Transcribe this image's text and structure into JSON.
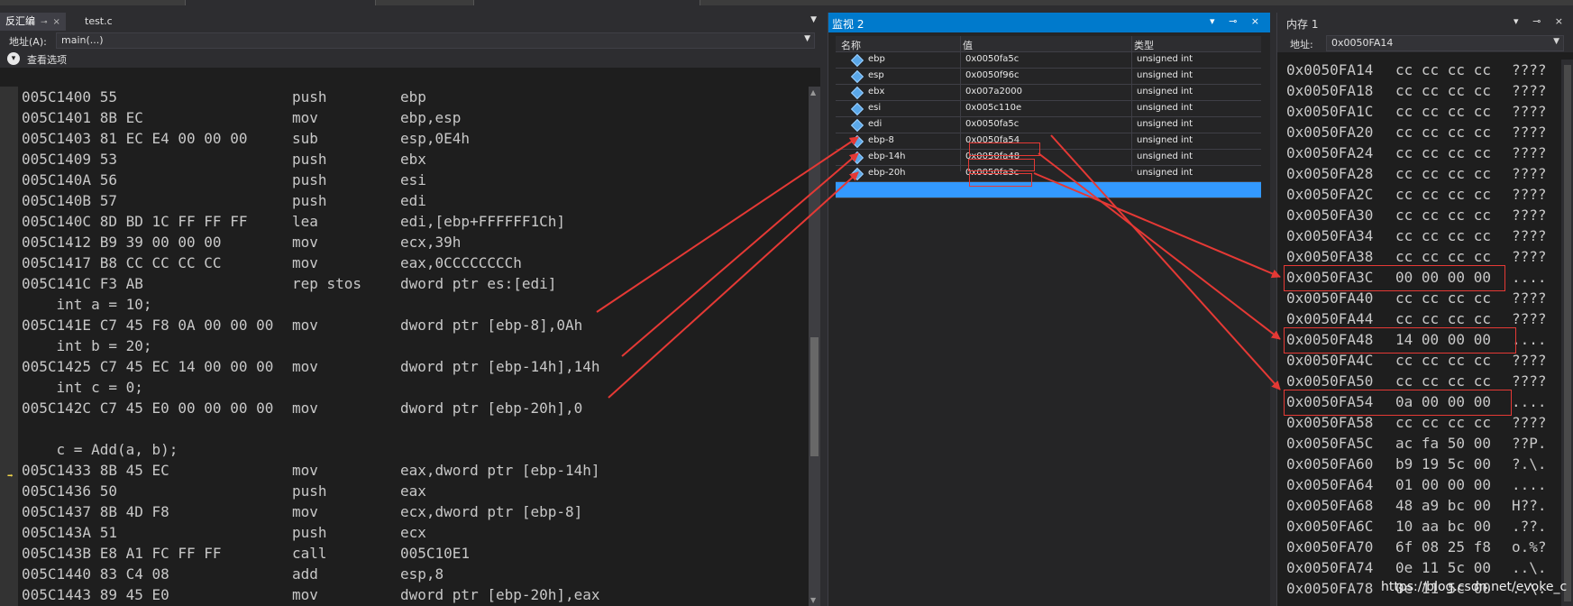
{
  "disasm_tabs": [
    {
      "label": "反汇编",
      "pin": "⊸",
      "close": "×"
    },
    {
      "label": "test.c"
    }
  ],
  "address_label": "地址(A):",
  "address_value": "main(...)",
  "view_options": "查看选项",
  "code_lines": [
    {
      "addr": "005C1400 55",
      "op": "push",
      "args": "ebp"
    },
    {
      "addr": "005C1401 8B EC",
      "op": "mov",
      "args": "ebp,esp"
    },
    {
      "addr": "005C1403 81 EC E4 00 00 00",
      "op": "sub",
      "args": "esp,0E4h"
    },
    {
      "addr": "005C1409 53",
      "op": "push",
      "args": "ebx"
    },
    {
      "addr": "005C140A 56",
      "op": "push",
      "args": "esi"
    },
    {
      "addr": "005C140B 57",
      "op": "push",
      "args": "edi"
    },
    {
      "addr": "005C140C 8D BD 1C FF FF FF",
      "op": "lea",
      "args": "edi,[ebp+FFFFFF1Ch]"
    },
    {
      "addr": "005C1412 B9 39 00 00 00",
      "op": "mov",
      "args": "ecx,39h"
    },
    {
      "addr": "005C1417 B8 CC CC CC CC",
      "op": "mov",
      "args": "eax,0CCCCCCCCh"
    },
    {
      "addr": "005C141C F3 AB",
      "op": "rep stos",
      "args": "dword ptr es:[edi]"
    },
    {
      "src": "    int a = 10;"
    },
    {
      "addr": "005C141E C7 45 F8 0A 00 00 00",
      "op": "mov",
      "args": "dword ptr [ebp-8],0Ah"
    },
    {
      "src": "    int b = 20;"
    },
    {
      "addr": "005C1425 C7 45 EC 14 00 00 00",
      "op": "mov",
      "args": "dword ptr [ebp-14h],14h"
    },
    {
      "src": "    int c = 0;"
    },
    {
      "addr": "005C142C C7 45 E0 00 00 00 00",
      "op": "mov",
      "args": "dword ptr [ebp-20h],0"
    },
    {
      "src": ""
    },
    {
      "src": "    c = Add(a, b);"
    },
    {
      "addr": "005C1433 8B 45 EC",
      "op": "mov",
      "args": "eax,dword ptr [ebp-14h]",
      "current": true
    },
    {
      "addr": "005C1436 50",
      "op": "push",
      "args": "eax"
    },
    {
      "addr": "005C1437 8B 4D F8",
      "op": "mov",
      "args": "ecx,dword ptr [ebp-8]"
    },
    {
      "addr": "005C143A 51",
      "op": "push",
      "args": "ecx"
    },
    {
      "addr": "005C143B E8 A1 FC FF FF",
      "op": "call",
      "args": "005C10E1"
    },
    {
      "addr": "005C1440 83 C4 08",
      "op": "add",
      "args": "esp,8"
    },
    {
      "addr": "005C1443 89 45 E0",
      "op": "mov",
      "args": "dword ptr [ebp-20h],eax"
    }
  ],
  "watch": {
    "title": "监视 2",
    "tools": "▾ ⊸ ×",
    "headers": {
      "name": "名称",
      "value": "值",
      "type": "类型"
    },
    "rows": [
      {
        "name": "ebp",
        "value": "0x0050fa5c",
        "type": "unsigned int"
      },
      {
        "name": "esp",
        "value": "0x0050f96c",
        "type": "unsigned int"
      },
      {
        "name": "ebx",
        "value": "0x007a2000",
        "type": "unsigned int"
      },
      {
        "name": "esi",
        "value": "0x005c110e",
        "type": "unsigned int"
      },
      {
        "name": "edi",
        "value": "0x0050fa5c",
        "type": "unsigned int"
      },
      {
        "name": "ebp-8",
        "value": "0x0050fa54",
        "type": "unsigned int"
      },
      {
        "name": "ebp-14h",
        "value": "0x0050fa48",
        "type": "unsigned int"
      },
      {
        "name": "ebp-20h",
        "value": "0x0050fa3c",
        "type": "unsigned int"
      }
    ]
  },
  "memory": {
    "title": "内存 1",
    "tools": "▾ ⊸ ×",
    "address_label": "地址:",
    "address_value": "0x0050FA14",
    "lines": [
      {
        "addr": "0x0050FA14",
        "bytes": "cc cc cc cc",
        "ascii": "????"
      },
      {
        "addr": "0x0050FA18",
        "bytes": "cc cc cc cc",
        "ascii": "????"
      },
      {
        "addr": "0x0050FA1C",
        "bytes": "cc cc cc cc",
        "ascii": "????"
      },
      {
        "addr": "0x0050FA20",
        "bytes": "cc cc cc cc",
        "ascii": "????"
      },
      {
        "addr": "0x0050FA24",
        "bytes": "cc cc cc cc",
        "ascii": "????"
      },
      {
        "addr": "0x0050FA28",
        "bytes": "cc cc cc cc",
        "ascii": "????"
      },
      {
        "addr": "0x0050FA2C",
        "bytes": "cc cc cc cc",
        "ascii": "????"
      },
      {
        "addr": "0x0050FA30",
        "bytes": "cc cc cc cc",
        "ascii": "????"
      },
      {
        "addr": "0x0050FA34",
        "bytes": "cc cc cc cc",
        "ascii": "????"
      },
      {
        "addr": "0x0050FA38",
        "bytes": "cc cc cc cc",
        "ascii": "????"
      },
      {
        "addr": "0x0050FA3C",
        "bytes": "00 00 00 00",
        "ascii": "...."
      },
      {
        "addr": "0x0050FA40",
        "bytes": "cc cc cc cc",
        "ascii": "????"
      },
      {
        "addr": "0x0050FA44",
        "bytes": "cc cc cc cc",
        "ascii": "????"
      },
      {
        "addr": "0x0050FA48",
        "bytes": "14 00 00 00",
        "ascii": "...."
      },
      {
        "addr": "0x0050FA4C",
        "bytes": "cc cc cc cc",
        "ascii": "????"
      },
      {
        "addr": "0x0050FA50",
        "bytes": "cc cc cc cc",
        "ascii": "????"
      },
      {
        "addr": "0x0050FA54",
        "bytes": "0a 00 00 00",
        "ascii": "...."
      },
      {
        "addr": "0x0050FA58",
        "bytes": "cc cc cc cc",
        "ascii": "????"
      },
      {
        "addr": "0x0050FA5C",
        "bytes": "ac fa 50 00",
        "ascii": "??P."
      },
      {
        "addr": "0x0050FA60",
        "bytes": "b9 19 5c 00",
        "ascii": "?.\\."
      },
      {
        "addr": "0x0050FA64",
        "bytes": "01 00 00 00",
        "ascii": "...."
      },
      {
        "addr": "0x0050FA68",
        "bytes": "48 a9 bc 00",
        "ascii": "H??."
      },
      {
        "addr": "0x0050FA6C",
        "bytes": "10 aa bc 00",
        "ascii": ".??."
      },
      {
        "addr": "0x0050FA70",
        "bytes": "6f 08 25 f8",
        "ascii": "o.%?"
      },
      {
        "addr": "0x0050FA74",
        "bytes": "0e 11 5c 00",
        "ascii": "..\\."
      },
      {
        "addr": "0x0050FA78",
        "bytes": "0e 11 5c 00",
        "ascii": "..\\."
      }
    ]
  },
  "watermark": "https://blog.csdn.net/evoke_c",
  "colors": {
    "accent": "#007acc",
    "highlight": "#e53935",
    "selection": "#3399ff"
  }
}
